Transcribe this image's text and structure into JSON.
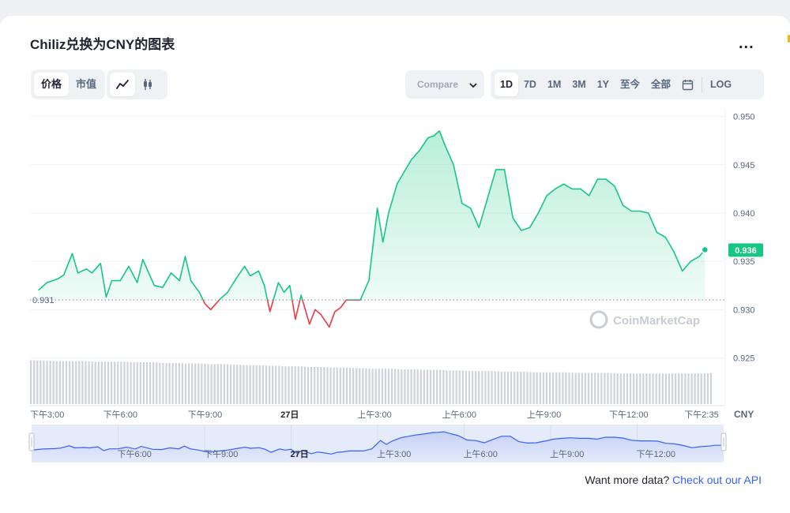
{
  "title": "Chiliz兑换为CNY的图表",
  "more_label": "...",
  "type_tabs": [
    "价格",
    "市值"
  ],
  "view_icons": [
    "line-chart-icon",
    "candlestick-icon"
  ],
  "compare_label": "Compare",
  "range_tabs": [
    "1D",
    "7D",
    "1M",
    "3M",
    "1Y",
    "至今",
    "全部"
  ],
  "log_label": "LOG",
  "api_text": "Want more data?",
  "api_link": "Check out our API",
  "watermark": "CoinMarketCap",
  "colors": {
    "up": "#16c784",
    "down": "#ea3943",
    "accent": "#3861fb"
  },
  "chart_data": {
    "type": "line",
    "currency": "CNY",
    "baseline": 0.931,
    "baseline_label": "0.931",
    "current_value": 0.936,
    "current_label": "0.936",
    "ylim": [
      0.9212,
      0.9516
    ],
    "yticks": [
      0.925,
      0.93,
      0.935,
      0.94,
      0.945,
      0.95
    ],
    "ytick_labels": [
      "0.925",
      "0.930",
      "0.935",
      "0.940",
      "0.945",
      "0.950"
    ],
    "xlim": [
      0,
      24
    ],
    "xticks": [
      {
        "x": 0,
        "label": "下午3:00"
      },
      {
        "x": 3,
        "label": "下午6:00"
      },
      {
        "x": 6,
        "label": "下午9:00"
      },
      {
        "x": 9,
        "label": "27日",
        "bold": true
      },
      {
        "x": 12,
        "label": "上午3:00"
      },
      {
        "x": 15,
        "label": "上午6:00"
      },
      {
        "x": 18,
        "label": "上午9:00"
      },
      {
        "x": 21,
        "label": "下午12:00"
      },
      {
        "x": 23.58,
        "label": "下午2:35"
      }
    ],
    "navigator_ticks": [
      {
        "x": 3,
        "label": "下午6:00"
      },
      {
        "x": 6,
        "label": "下午9:00"
      },
      {
        "x": 9,
        "label": "27日",
        "bold": true
      },
      {
        "x": 12,
        "label": "上午3:00"
      },
      {
        "x": 15,
        "label": "上午6:00"
      },
      {
        "x": 18,
        "label": "上午9:00"
      },
      {
        "x": 21,
        "label": "下午12:00"
      }
    ],
    "x": [
      0.1,
      0.4,
      0.8,
      1.0,
      1.3,
      1.5,
      1.8,
      2.0,
      2.3,
      2.5,
      2.7,
      3.0,
      3.3,
      3.6,
      3.8,
      4.2,
      4.5,
      4.8,
      5.1,
      5.3,
      5.5,
      5.8,
      6.0,
      6.2,
      6.5,
      6.8,
      7.1,
      7.4,
      7.6,
      7.9,
      8.1,
      8.3,
      8.6,
      8.8,
      9.0,
      9.2,
      9.4,
      9.7,
      9.9,
      10.1,
      10.4,
      10.6,
      10.8,
      11.0,
      11.2,
      11.5,
      11.8,
      12.1,
      12.3,
      12.5,
      12.8,
      13.0,
      13.3,
      13.6,
      13.9,
      14.1,
      14.3,
      14.5,
      14.8,
      15.1,
      15.4,
      15.7,
      16.0,
      16.3,
      16.6,
      16.9,
      17.2,
      17.5,
      17.8,
      18.1,
      18.4,
      18.7,
      19.0,
      19.3,
      19.6,
      19.9,
      20.2,
      20.5,
      20.8,
      21.1,
      21.4,
      21.7,
      22.0,
      22.3,
      22.6,
      22.9,
      23.2,
      23.5,
      23.7
    ],
    "y": [
      0.932,
      0.9328,
      0.9332,
      0.9336,
      0.9358,
      0.9338,
      0.9342,
      0.9338,
      0.9348,
      0.9313,
      0.933,
      0.933,
      0.9345,
      0.9328,
      0.9352,
      0.9325,
      0.9323,
      0.9338,
      0.933,
      0.9355,
      0.933,
      0.9318,
      0.9306,
      0.93,
      0.931,
      0.9318,
      0.9332,
      0.9345,
      0.9335,
      0.934,
      0.9325,
      0.9298,
      0.9328,
      0.9318,
      0.9325,
      0.929,
      0.9315,
      0.9285,
      0.93,
      0.9295,
      0.9282,
      0.9298,
      0.9302,
      0.931,
      0.931,
      0.931,
      0.933,
      0.9405,
      0.937,
      0.94,
      0.943,
      0.944,
      0.9455,
      0.9465,
      0.9478,
      0.948,
      0.9485,
      0.947,
      0.945,
      0.941,
      0.9405,
      0.9385,
      0.9415,
      0.9445,
      0.9445,
      0.9395,
      0.9382,
      0.9385,
      0.94,
      0.9418,
      0.9425,
      0.943,
      0.9425,
      0.9425,
      0.9418,
      0.9435,
      0.9435,
      0.9428,
      0.9408,
      0.9402,
      0.9402,
      0.94,
      0.938,
      0.9375,
      0.936,
      0.934,
      0.935,
      0.9355,
      0.9362
    ],
    "volume": [
      0.74,
      0.74,
      0.74,
      0.73,
      0.73,
      0.73,
      0.73,
      0.73,
      0.72,
      0.72,
      0.72,
      0.72,
      0.72,
      0.71,
      0.71,
      0.71,
      0.71,
      0.7,
      0.7,
      0.7,
      0.69,
      0.69,
      0.69,
      0.68,
      0.68,
      0.68,
      0.67,
      0.67,
      0.66,
      0.66,
      0.66,
      0.65,
      0.65,
      0.64,
      0.64,
      0.64,
      0.63,
      0.63,
      0.63,
      0.62,
      0.62,
      0.62,
      0.61,
      0.61,
      0.6,
      0.6,
      0.6,
      0.6,
      0.59,
      0.59,
      0.59,
      0.58,
      0.58,
      0.58,
      0.57,
      0.57,
      0.57,
      0.56,
      0.56,
      0.56,
      0.56,
      0.55,
      0.55,
      0.55,
      0.55,
      0.54,
      0.54,
      0.54,
      0.54,
      0.54,
      0.53,
      0.53,
      0.53,
      0.53,
      0.53,
      0.53,
      0.52,
      0.52,
      0.52,
      0.52,
      0.52,
      0.52,
      0.52,
      0.52,
      0.52,
      0.52,
      0.52,
      0.52,
      0.53
    ]
  }
}
